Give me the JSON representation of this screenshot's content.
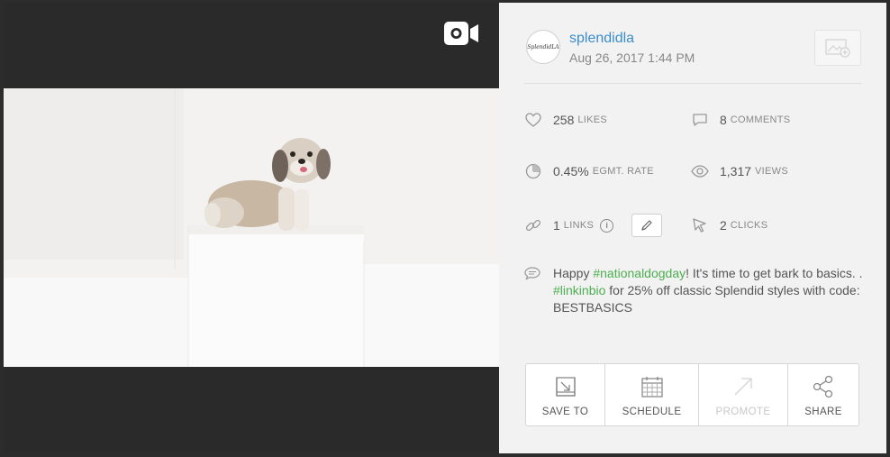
{
  "post": {
    "username": "splendidla",
    "avatar_text": "SplendidLA",
    "date": "Aug 26, 2017 1:44 PM"
  },
  "stats": {
    "likes": {
      "value": "258",
      "label": "LIKES"
    },
    "comments": {
      "value": "8",
      "label": "COMMENTS"
    },
    "engagement": {
      "value": "0.45%",
      "label": "EGMT. RATE"
    },
    "views": {
      "value": "1,317",
      "label": "VIEWS"
    },
    "links": {
      "value": "1",
      "label": "LINKS",
      "info": "i"
    },
    "clicks": {
      "value": "2",
      "label": "CLICKS"
    }
  },
  "caption": {
    "part1": "Happy ",
    "tag1": "#nationaldogday",
    "part2": "! It's time to get bark to basics. . ",
    "tag2": "#linkinbio",
    "part3": " for 25% off classic Splendid styles with code: BESTBASICS"
  },
  "actions": {
    "save": "SAVE TO",
    "schedule": "SCHEDULE",
    "promote": "PROMOTE",
    "share": "SHARE"
  },
  "colors": {
    "link_blue": "#3c8dca",
    "hashtag_green": "#4caf50"
  }
}
